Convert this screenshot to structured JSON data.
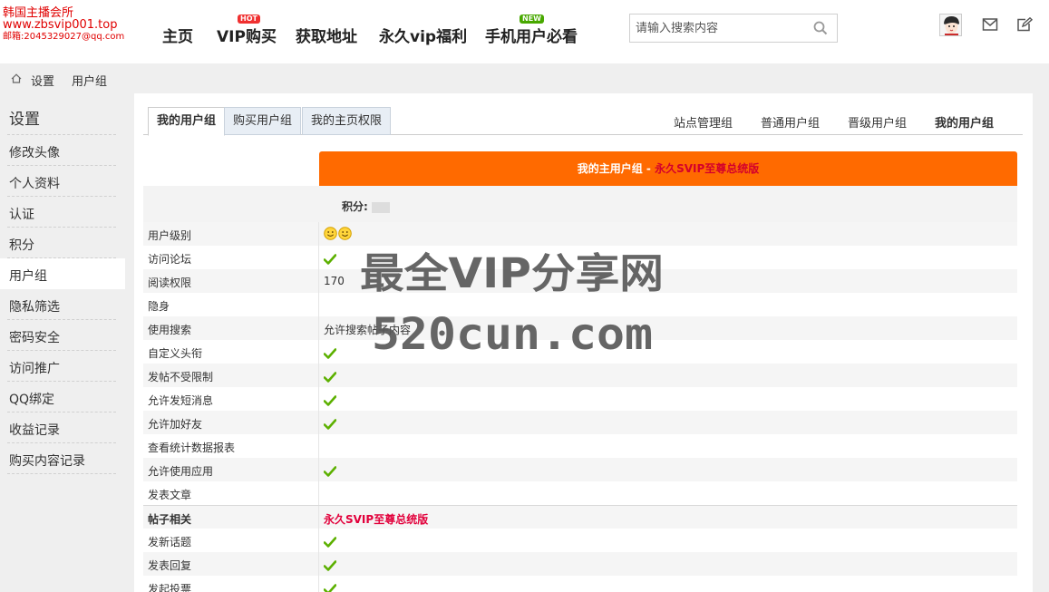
{
  "header": {
    "logo": {
      "line1": "韩国主播会所",
      "line2": "www.zbsvip001.top",
      "line3": "邮箱:2045329027@qq.com"
    },
    "nav": [
      {
        "label": "主页"
      },
      {
        "label": "VIP购买",
        "badge": "HOT"
      },
      {
        "label": "获取地址"
      },
      {
        "label": "永久vip福利"
      },
      {
        "label": "手机用户必看",
        "badge": "NEW"
      }
    ],
    "search": {
      "placeholder": "请输入搜索内容",
      "icon": "search-icon"
    },
    "icons": [
      "avatar",
      "mail-icon",
      "edit-icon"
    ]
  },
  "breadcrumb": {
    "items": [
      "设置",
      "用户组"
    ]
  },
  "sidebar": {
    "title": "设置",
    "items": [
      {
        "label": "修改头像"
      },
      {
        "label": "个人资料"
      },
      {
        "label": "认证"
      },
      {
        "label": "积分"
      },
      {
        "label": "用户组",
        "active": true
      },
      {
        "label": "隐私筛选"
      },
      {
        "label": "密码安全"
      },
      {
        "label": "访问推广"
      },
      {
        "label": "QQ绑定"
      },
      {
        "label": "收益记录"
      },
      {
        "label": "购买内容记录"
      }
    ]
  },
  "tabs": {
    "left": [
      "我的用户组",
      "购买用户组",
      "我的主页权限"
    ],
    "right": [
      "站点管理组",
      "普通用户组",
      "晋级用户组",
      "我的用户组"
    ]
  },
  "group": {
    "title_prefix": "我的主用户组 - ",
    "title_name": "永久SVIP至尊总统版",
    "score_label": "积分:",
    "rows": [
      {
        "label": "用户级别",
        "type": "stars"
      },
      {
        "label": "访问论坛",
        "type": "check"
      },
      {
        "label": "阅读权限",
        "type": "text",
        "value": "170"
      },
      {
        "label": "隐身",
        "type": "none"
      },
      {
        "label": "使用搜索",
        "type": "text",
        "value": "允许搜索帖子内容"
      },
      {
        "label": "自定义头衔",
        "type": "check"
      },
      {
        "label": "发帖不受限制",
        "type": "check"
      },
      {
        "label": "允许发短消息",
        "type": "check"
      },
      {
        "label": "允许加好友",
        "type": "check"
      },
      {
        "label": "查看统计数据报表",
        "type": "none"
      },
      {
        "label": "允许使用应用",
        "type": "check"
      },
      {
        "label": "发表文章",
        "type": "none"
      },
      {
        "label": "帖子相关",
        "type": "head",
        "value": "永久SVIP至尊总统版"
      },
      {
        "label": "发新话题",
        "type": "check"
      },
      {
        "label": "发表回复",
        "type": "check"
      },
      {
        "label": "发起投票",
        "type": "check"
      }
    ]
  },
  "watermark": {
    "line1": "最全VIP分享网",
    "line2": "520cun.com"
  },
  "colors": {
    "accent": "#ff6a00",
    "highlight": "#e2003b",
    "check": "#5cb000"
  }
}
